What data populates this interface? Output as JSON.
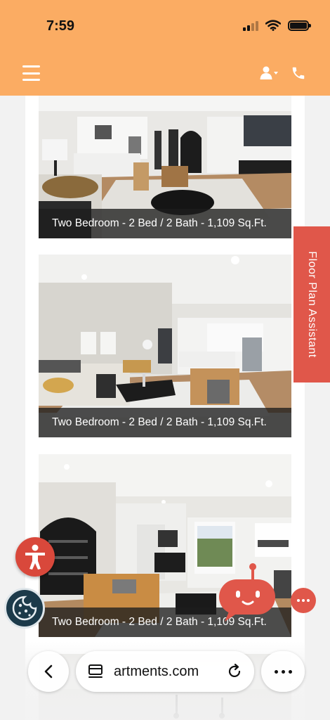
{
  "status_bar": {
    "time": "7:59"
  },
  "header": {
    "menu_icon": "hamburger-menu-icon",
    "user_icon": "user-dropdown-icon",
    "phone_icon": "phone-icon",
    "background": "#fbac63"
  },
  "floor_plans": [
    {
      "caption": "Two Bedroom - 2 Bed / 2 Bath - 1,109 Sq.Ft."
    },
    {
      "caption": "Two Bedroom - 2 Bed / 2 Bath - 1,109 Sq.Ft."
    },
    {
      "caption": "Two Bedroom - 2 Bed / 2 Bath - 1,109 Sq.Ft."
    }
  ],
  "side_tab": {
    "label": "Floor Plan Assistant",
    "color": "#e0574a"
  },
  "widgets": {
    "accessibility_icon": "accessibility-person-icon",
    "cookie_icon": "cookie-icon",
    "chatbot_icon": "robot-chat-icon",
    "more_icon": "more-dots-icon"
  },
  "browser": {
    "url": "artments.com",
    "back_icon": "chevron-left-icon",
    "tabs_icon": "tab-overview-icon",
    "reload_icon": "reload-icon",
    "menu_icon": "more-horizontal-icon"
  }
}
